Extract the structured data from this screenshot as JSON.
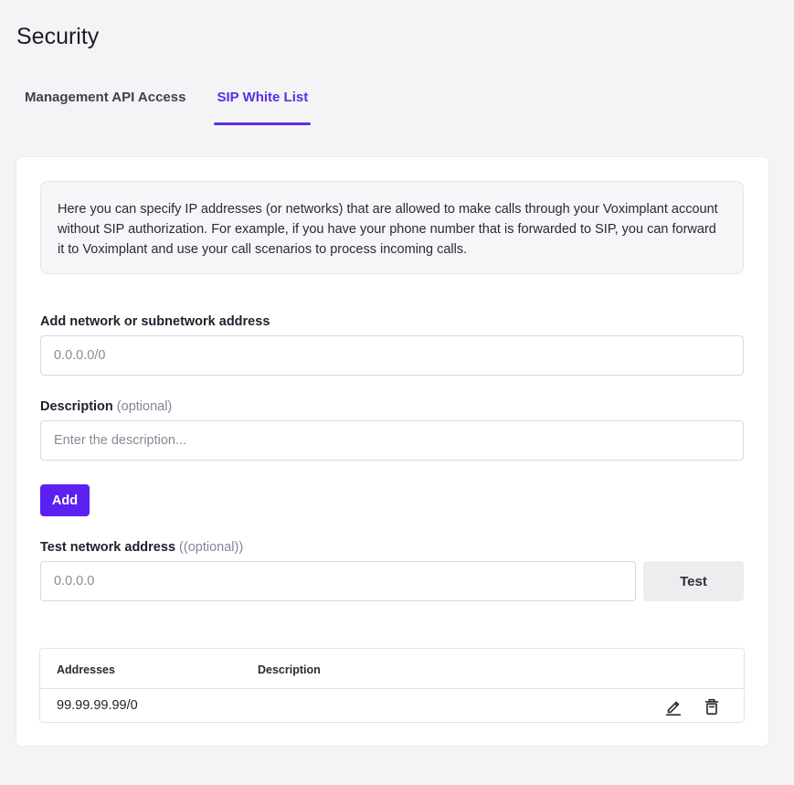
{
  "page": {
    "title": "Security"
  },
  "tabs": [
    {
      "label": "Management API Access",
      "active": false
    },
    {
      "label": "SIP White List",
      "active": true
    }
  ],
  "info": {
    "text": "Here you can specify IP addresses (or networks) that are allowed to make calls through your Voximplant account without SIP authorization. For example, if you have your phone number that is forwarded to SIP, you can forward it to Voximplant and use your call scenarios to process incoming calls."
  },
  "form": {
    "network_label": "Add network or subnetwork address",
    "network_placeholder": "0.0.0.0/0",
    "network_value": "",
    "description_label": "Description",
    "description_optional": "(optional)",
    "description_placeholder": "Enter the description...",
    "description_value": "",
    "add_label": "Add",
    "test_label": "Test network address",
    "test_optional": "((optional))",
    "test_placeholder": "0.0.0.0",
    "test_value": "",
    "test_button": "Test"
  },
  "table": {
    "columns": [
      "Addresses",
      "Description"
    ],
    "rows": [
      {
        "address": "99.99.99.99/0",
        "description": ""
      }
    ]
  },
  "icons": {
    "edit": "pencil-edit-icon",
    "delete": "trash-icon"
  },
  "colors": {
    "accent": "#5b2ee6",
    "primary_button": "#5b20f2",
    "background": "#f4f4f6"
  }
}
